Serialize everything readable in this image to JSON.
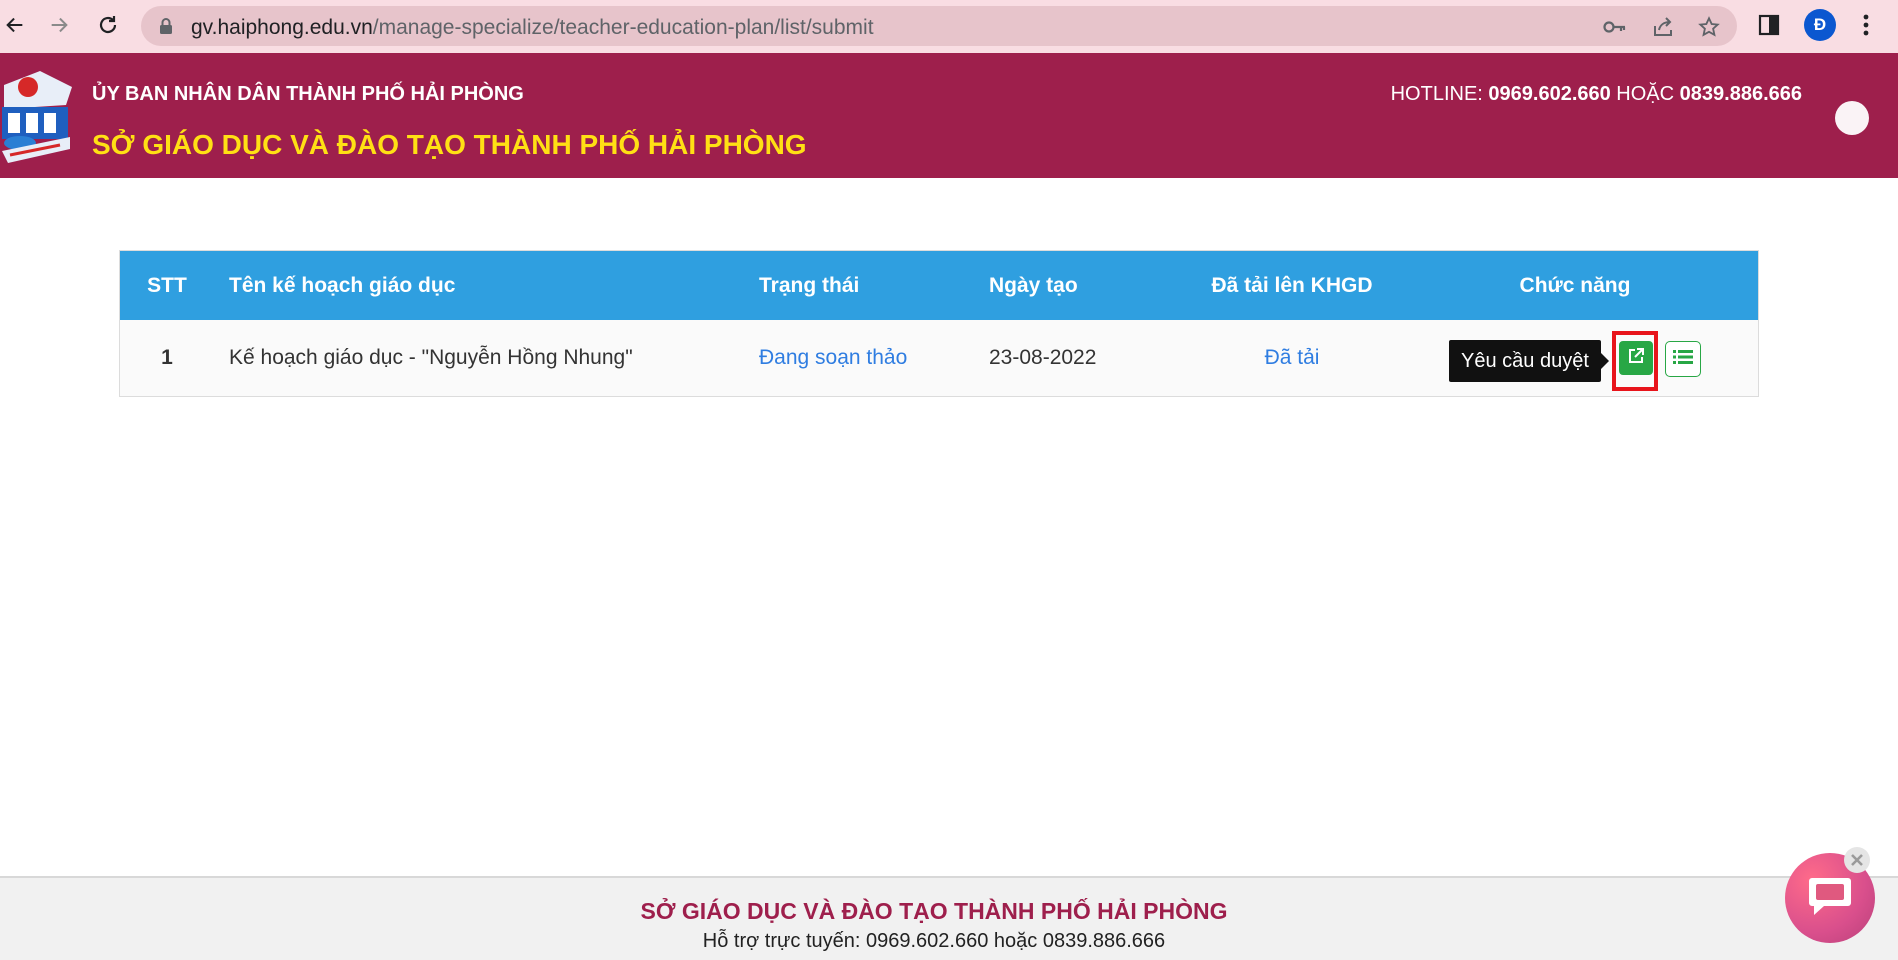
{
  "browser": {
    "url_host": "gv.haiphong.edu.vn",
    "url_path": "/manage-specialize/teacher-education-plan/list/submit",
    "profile_initial": "Đ"
  },
  "header": {
    "gov_title": "ỦY BAN NHÂN DÂN THÀNH PHỐ HẢI PHÒNG",
    "dept_title": "SỞ GIÁO DỤC VÀ ĐÀO TẠO THÀNH PHỐ HẢI PHÒNG",
    "hotline_label": "HOTLINE: ",
    "hotline_1": "0969.602.660",
    "hotline_or": " HOẶC ",
    "hotline_2": "0839.886.666"
  },
  "table": {
    "columns": [
      "STT",
      "Tên kế hoạch giáo dục",
      "Trạng thái",
      "Ngày tạo",
      "Đã tải lên KHGD",
      "Chức năng"
    ],
    "rows": [
      {
        "stt": "1",
        "name": "Kế hoạch giáo dục - \"Nguyễn Hồng Nhung\"",
        "status": "Đang soạn thảo",
        "date": "23-08-2022",
        "uploaded": "Đã tải"
      }
    ]
  },
  "tooltip": "Yêu cầu duyệt",
  "icons": {
    "submit": "external-link-icon",
    "list": "list-icon"
  },
  "colors": {
    "brand": "#9e1f4c",
    "dept_title": "#ffe014",
    "table_header": "#2f9fe0",
    "link": "#2f7de1",
    "action_green": "#28a745",
    "highlight": "#e8141b"
  },
  "footer": {
    "title": "SỞ GIÁO DỤC VÀ ĐÀO TẠO THÀNH PHỐ HẢI PHÒNG",
    "support": "Hỗ trợ trực tuyến: 0969.602.660 hoặc 0839.886.666"
  }
}
